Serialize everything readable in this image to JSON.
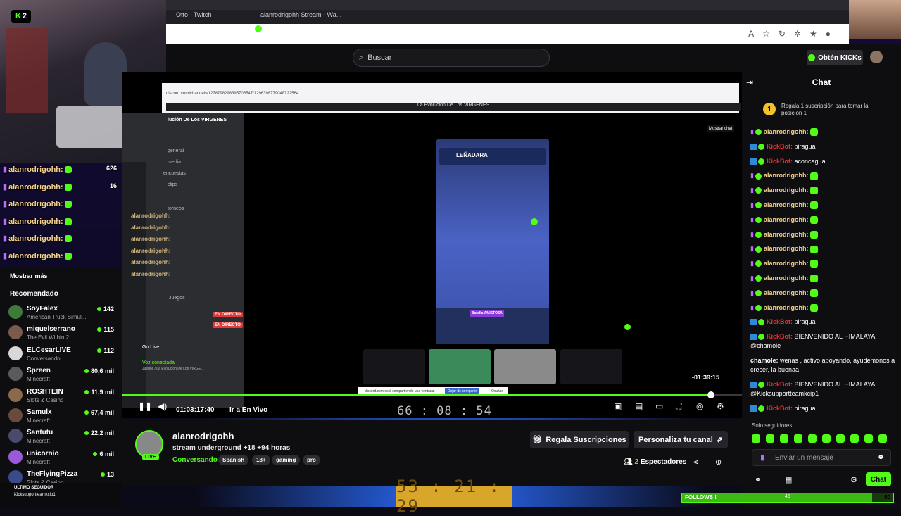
{
  "browser": {
    "tabs": [
      "Otto - Twitch",
      "alanrodrigohh Stream - Wa..."
    ],
    "address_icons": [
      "reader-icon",
      "star-icon",
      "refresh-icon",
      "extension-icon",
      "favorites-icon",
      "profile-icon"
    ]
  },
  "header": {
    "search_placeholder": "Buscar",
    "kicks_button": "Obtén KICKs",
    "brand_color": "#53fc18"
  },
  "overlay": {
    "k_badge": "2",
    "chat_lines": [
      {
        "user": "alanrodrigohh:",
        "count": "626"
      },
      {
        "user": "alanrodrigohh:",
        "count": "16"
      },
      {
        "user": "alanrodrigohh:",
        "count": ""
      },
      {
        "user": "alanrodrigohh:",
        "count": ""
      },
      {
        "user": "alanrodrigohh:",
        "count": ""
      },
      {
        "user": "alanrodrigohh:",
        "count": ""
      }
    ],
    "faded_chat_lines": [
      "alanrodrigohh:",
      "alanrodrigohh:",
      "alanrodrigohh:",
      "alanrodrigohh:",
      "alanrodrigohh:",
      "alanrodrigohh:"
    ]
  },
  "sidebar": {
    "show_more": "Mostrar más",
    "recommended_title": "Recomendado",
    "items": [
      {
        "name": "SoyFalex",
        "game": "American Truck Simul...",
        "viewers": "142"
      },
      {
        "name": "miquelserrano",
        "game": "The Evil Within 2",
        "viewers": "115"
      },
      {
        "name": "ELCesarLIVE",
        "game": "Conversando",
        "viewers": "112"
      },
      {
        "name": "Spreen",
        "game": "Minecraft",
        "viewers": "80,6 mil"
      },
      {
        "name": "ROSHTEIN",
        "game": "Slots & Casino",
        "viewers": "11,9 mil"
      },
      {
        "name": "Samulx",
        "game": "Minecraft",
        "viewers": "67,4 mil"
      },
      {
        "name": "Santutu",
        "game": "Minecraft",
        "viewers": "22,2 mil"
      },
      {
        "name": "unicornio",
        "game": "Minecraft",
        "viewers": "6 mil"
      },
      {
        "name": "TheFlyingPizza",
        "game": "Slots & Casino",
        "viewers": "13"
      }
    ],
    "last_follower_label": "ULTIMO SEGUIDOR",
    "last_follower_name": "Kicksupportteamkcip1"
  },
  "video": {
    "inner_address": "discord.com/channels/1278798298395705547/1296398779048722564",
    "discord_title": "La Evolución De Los VIRGENES",
    "server_name": "lución De Los VIRGENES",
    "channels": [
      "general",
      "media",
      "encuestas",
      "clips",
      "torneos"
    ],
    "voice_channel": "Juegos",
    "voice_status": "Voz conectada",
    "voice_sub": "Juegos / La Evolución De Los VIRGE...",
    "live_badge": "EN DIRECTO",
    "go_live": "Go Live",
    "game_top_label": "LEÑADARA",
    "game_buttons": [
      "Batalla AMISTOSA"
    ],
    "tooltip": "Mostrar chat",
    "share_notice": "discord.com está compartiendo una ventana.",
    "share_stop": "Dejar de compartir",
    "share_hide": "Ocultar",
    "inner_timer": "-01:39:15",
    "elapsed": "01:03:17:40",
    "go_to_live": "Ir a En Vivo",
    "counter": "66 : 08 : 54",
    "progress": 0.95
  },
  "stream": {
    "live_label": "LIVE",
    "name": "alanrodrigohh",
    "title": "stream underground +18 +94 horas",
    "category": "Conversando",
    "tags": [
      "Spanish",
      "18+",
      "gaming",
      "pro"
    ],
    "gift_button": "Regala Suscripciones",
    "customize_button": "Personaliza tu canal",
    "viewer_count": "2",
    "viewer_label": "Espectadores"
  },
  "chat": {
    "title": "Chat",
    "promo_coin": "1",
    "promo_text": "Regala 1 suscripción para tomar la posición 1",
    "messages": [
      {
        "user": "alanrodrigohh:",
        "type": "alan",
        "text": ""
      },
      {
        "user": "KickBot:",
        "type": "bot",
        "text": "piragua"
      },
      {
        "user": "KickBot:",
        "type": "bot",
        "text": "aconcagua"
      },
      {
        "user": "alanrodrigohh:",
        "type": "alan",
        "text": ""
      },
      {
        "user": "alanrodrigohh:",
        "type": "alan",
        "text": ""
      },
      {
        "user": "alanrodrigohh:",
        "type": "alan",
        "text": ""
      },
      {
        "user": "alanrodrigohh:",
        "type": "alan",
        "text": ""
      },
      {
        "user": "alanrodrigohh:",
        "type": "alan",
        "text": ""
      },
      {
        "user": "alanrodrigohh:",
        "type": "alan",
        "text": ""
      },
      {
        "user": "alanrodrigohh:",
        "type": "alan",
        "text": ""
      },
      {
        "user": "alanrodrigohh:",
        "type": "alan",
        "text": ""
      },
      {
        "user": "alanrodrigohh:",
        "type": "alan",
        "text": ""
      },
      {
        "user": "alanrodrigohh:",
        "type": "alan",
        "text": ""
      },
      {
        "user": "KickBot:",
        "type": "bot",
        "text": "piragua"
      },
      {
        "user": "KickBot:",
        "type": "bot",
        "text": "BIENVENIDO AL HIMALAYA @chamole"
      },
      {
        "user": "chamole:",
        "type": "plain",
        "text": "wenas , activo apoyando, ayudemonos a crecer, la buenaa"
      },
      {
        "user": "KickBot:",
        "type": "bot",
        "text": "BIENVENIDO AL HIMALAYA @Kicksupportteamkcip1"
      },
      {
        "user": "KickBot:",
        "type": "bot",
        "text": "piragua"
      }
    ],
    "followers_only": "Solo seguidores",
    "input_placeholder": "Enviar un mensaje",
    "send_button": "Chat"
  },
  "bottom": {
    "counter": "53 : 21 : 29",
    "follows_label": "FOLLOWS !",
    "follows_current": "45",
    "follows_goal": "50",
    "follows_current_value": 45,
    "follows_goal_value": 50
  }
}
